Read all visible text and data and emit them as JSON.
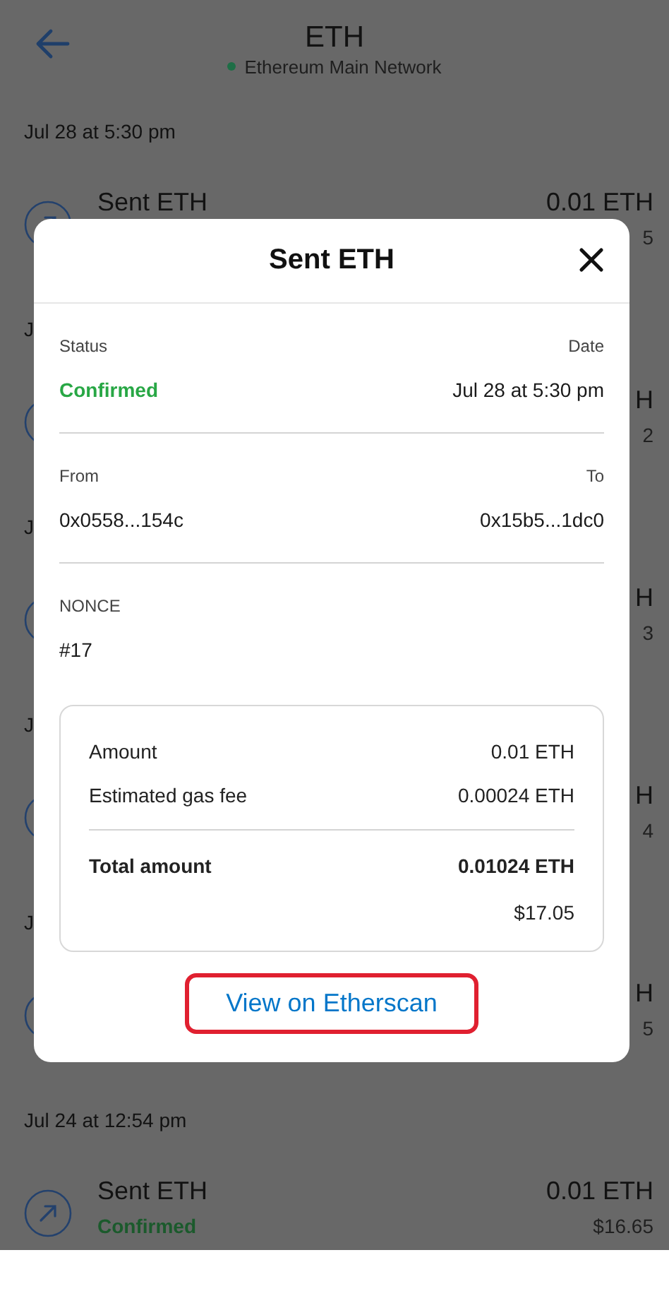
{
  "header": {
    "title": "ETH",
    "network": "Ethereum Main Network"
  },
  "activity": [
    {
      "kind": "date",
      "text": "Jul 28 at 5:30 pm"
    },
    {
      "kind": "tx",
      "title": "Sent ETH",
      "amount": "0.01 ETH",
      "fiat": "5"
    },
    {
      "kind": "date",
      "text": "J"
    },
    {
      "kind": "tx",
      "amount": "H",
      "fiat": "2"
    },
    {
      "kind": "date",
      "text": "J"
    },
    {
      "kind": "tx",
      "amount": "H",
      "fiat": "3"
    },
    {
      "kind": "date",
      "text": "J"
    },
    {
      "kind": "tx",
      "amount": "H",
      "fiat": "4"
    },
    {
      "kind": "date",
      "text": "J"
    },
    {
      "kind": "tx",
      "amount": "H",
      "fiat": "5"
    },
    {
      "kind": "date",
      "text": "Jul 24 at 12:54 pm"
    },
    {
      "kind": "tx",
      "title": "Sent ETH",
      "status": "Confirmed",
      "amount": "0.01 ETH",
      "fiat": "$16.65"
    }
  ],
  "modal": {
    "title": "Sent ETH",
    "status_label": "Status",
    "status": "Confirmed",
    "date_label": "Date",
    "date": "Jul 28 at 5:30 pm",
    "from_label": "From",
    "from": "0x0558...154c",
    "to_label": "To",
    "to": "0x15b5...1dc0",
    "nonce_label": "NONCE",
    "nonce": "#17",
    "summary": [
      {
        "kind": "line",
        "label": "Amount",
        "value": "0.01 ETH"
      },
      {
        "kind": "line",
        "label": "Estimated gas fee",
        "value": "0.00024 ETH"
      },
      {
        "kind": "total",
        "label": "Total amount",
        "value": "0.01024 ETH"
      },
      {
        "kind": "fiat",
        "value": "$17.05"
      }
    ],
    "link": {
      "text": "View on Etherscan",
      "highlighted": true
    }
  }
}
